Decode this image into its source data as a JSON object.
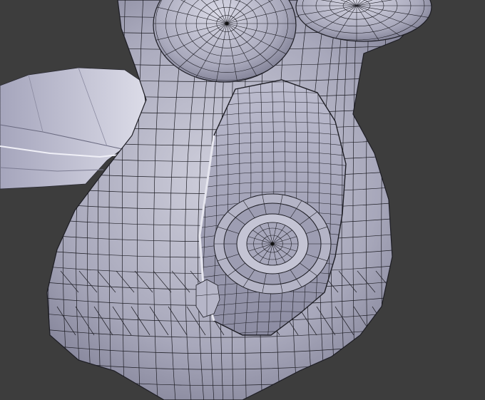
{
  "viewport": {
    "background": "#3d3d3d",
    "mesh_fill": "#a9a9bd",
    "mesh_fill_light": "#c8c8d6",
    "mesh_fill_dark": "#6f6f82",
    "wire_color": "#1d1d24"
  }
}
